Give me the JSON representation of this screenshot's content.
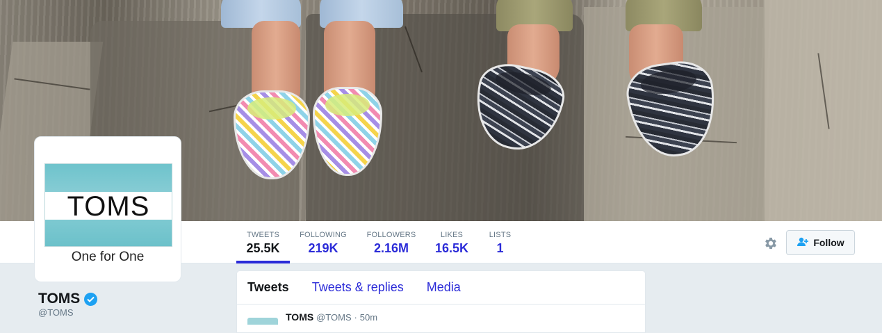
{
  "profile": {
    "name": "TOMS",
    "handle": "@TOMS",
    "verified": true,
    "logo_word": "TOMS",
    "logo_tagline": "One for One"
  },
  "stats": [
    {
      "label": "TWEETS",
      "value": "25.5K",
      "active": true
    },
    {
      "label": "FOLLOWING",
      "value": "219K",
      "active": false
    },
    {
      "label": "FOLLOWERS",
      "value": "2.16M",
      "active": false
    },
    {
      "label": "LIKES",
      "value": "16.5K",
      "active": false
    },
    {
      "label": "LISTS",
      "value": "1",
      "active": false
    }
  ],
  "actions": {
    "settings_icon": "gear-icon",
    "follow_label": "Follow",
    "follow_icon": "add-user-icon"
  },
  "timeline": {
    "tabs": [
      {
        "label": "Tweets",
        "active": true
      },
      {
        "label": "Tweets & replies",
        "active": false
      },
      {
        "label": "Media",
        "active": false
      }
    ],
    "first_tweet": {
      "name": "TOMS",
      "handle": "@TOMS",
      "separator": "·",
      "time": "50m"
    }
  },
  "colors": {
    "link": "#2b2bd8",
    "text": "#14171a",
    "muted": "#657786",
    "verified": "#1da1f2",
    "page_bg": "#e6ecf0",
    "logo_blue": "#7cc8d0"
  }
}
